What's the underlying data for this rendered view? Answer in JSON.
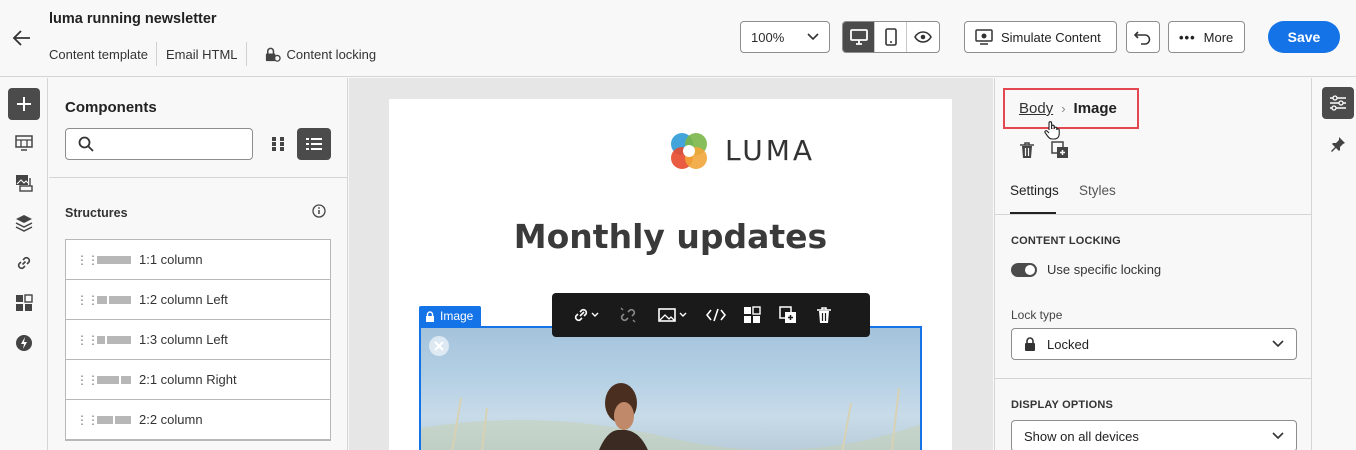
{
  "header": {
    "title": "luma running newsletter",
    "subnav": [
      "Content template",
      "Email HTML"
    ],
    "content_locking": "Content locking",
    "zoom": "100%",
    "simulate": "Simulate Content",
    "more": "More",
    "save": "Save"
  },
  "rail": {
    "icons": [
      "add-icon",
      "fragment-icon",
      "assets-icon",
      "layers-icon",
      "link-icon",
      "components-icon",
      "dynamic-icon"
    ]
  },
  "components": {
    "title": "Components",
    "search_placeholder": "",
    "structures_label": "Structures",
    "structures": [
      {
        "label": "1:1 column"
      },
      {
        "label": "1:2 column Left"
      },
      {
        "label": "1:3 column Left"
      },
      {
        "label": "2:1 column Right"
      },
      {
        "label": "2:2 column"
      }
    ]
  },
  "canvas": {
    "logo_text": "LUMA",
    "heading": "Monthly updates",
    "image_tag": "Image"
  },
  "right_panel": {
    "breadcrumb_parent": "Body",
    "breadcrumb_current": "Image",
    "tabs": [
      "Settings",
      "Styles"
    ],
    "content_locking_title": "CONTENT LOCKING",
    "toggle_label": "Use specific locking",
    "lock_type_label": "Lock type",
    "lock_type_value": "Locked",
    "display_options_title": "DISPLAY OPTIONS",
    "display_value": "Show on all devices"
  },
  "colors": {
    "accent": "#1473e6",
    "highlight": "#e34850",
    "dark": "#4b4b4b"
  }
}
